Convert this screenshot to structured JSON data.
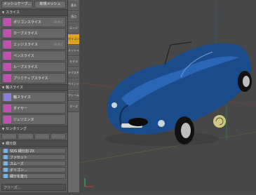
{
  "panel": {
    "top": [
      "メッシュケーブ...",
      "新規メッシュ"
    ],
    "sec1": "スライス",
    "tools1": [
      {
        "label": "ポリゴンスライス",
        "sc": "Shift C",
        "color": "#c34fb3"
      },
      {
        "label": "カーブスライス",
        "sc": "",
        "color": "#c34fb3"
      },
      {
        "label": "エッジスライス",
        "sc": "Shift C",
        "color": "#c34fb3"
      },
      {
        "label": "ペンスライス",
        "sc": "",
        "color": "#c34fb3"
      },
      {
        "label": "ループスライス",
        "sc": "",
        "color": "#c34fb3"
      },
      {
        "label": "プリミティブスライス",
        "sc": "",
        "color": "#c34fb3"
      }
    ],
    "sec2": "軸スライス",
    "tools2": [
      {
        "label": "軸スライス",
        "color": "#8a7fd6"
      },
      {
        "label": "ダイサー",
        "color": "#c34fb3"
      },
      {
        "label": "ジュリエンヌ",
        "color": "#c34fb3"
      }
    ],
    "sec3": "センタリング",
    "sec4": "細分割",
    "tools4": [
      {
        "label": "SDS 細分割 2X",
        "color": "#7ab0e8"
      },
      {
        "label": "ファセット",
        "color": "#7ab0e8"
      },
      {
        "label": "スムーズ",
        "color": "#7ab0e8"
      },
      {
        "label": "ポリゴン...",
        "color": "#7ab0e8"
      },
      {
        "label": "細分化復元",
        "color": "#7ab0e8"
      }
    ],
    "footer": "フリーズ..."
  },
  "strip": [
    "基本",
    "頂点",
    "エッジ",
    "ポリゴン",
    "メッシュ",
    "モデル",
    "テクスチャ",
    "ペイント",
    "フレーム",
    "ポーズ"
  ]
}
